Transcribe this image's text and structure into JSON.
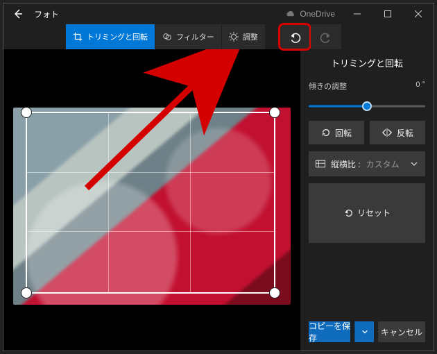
{
  "titlebar": {
    "app_name": "フォト",
    "onedrive_label": "OneDrive"
  },
  "toolbar": {
    "crop_label": "トリミングと回転",
    "filter_label": "フィルター",
    "adjust_label": "調整"
  },
  "panel": {
    "title": "トリミングと回転",
    "tilt_label": "傾きの調整",
    "tilt_value": "0 °",
    "rotate_label": "回転",
    "flip_label": "反転",
    "aspect_label": "縦横比 :",
    "aspect_value": "カスタム",
    "reset_label": "リセット"
  },
  "footer": {
    "save_label": "コピーを保存",
    "cancel_label": "キャンセル"
  }
}
